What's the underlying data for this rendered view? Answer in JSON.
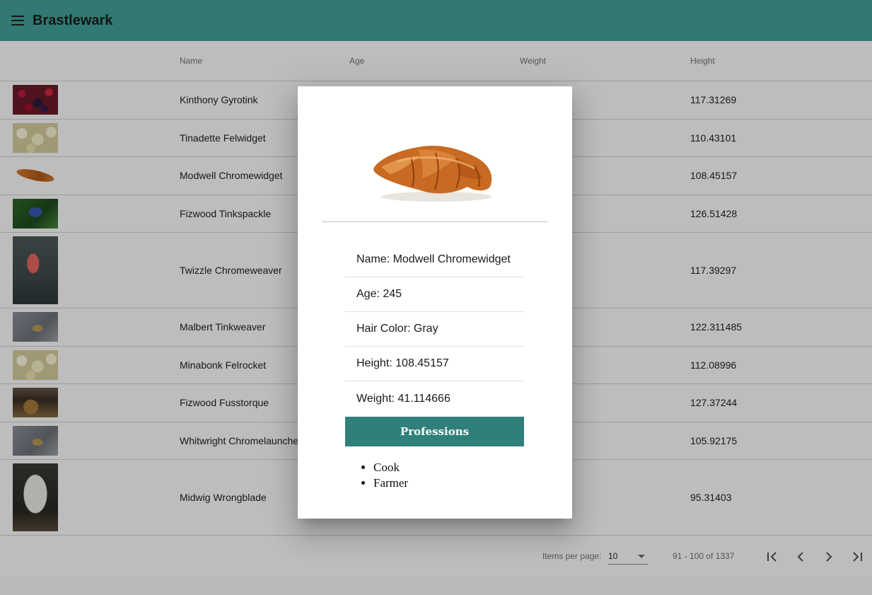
{
  "app": {
    "title": "Brastlewark"
  },
  "table": {
    "columns": [
      "",
      "Name",
      "Age",
      "Weight",
      "Height"
    ],
    "rows": [
      {
        "thumb": "berries",
        "name": "Kinthony Gyrotink",
        "height": "117.31269"
      },
      {
        "thumb": "popcorn",
        "name": "Tinadette Felwidget",
        "height": "110.43101"
      },
      {
        "thumb": "croissant",
        "name": "Modwell Chromewidget",
        "height": "108.45157"
      },
      {
        "thumb": "butterfly",
        "name": "Fizwood Tinkspackle",
        "height": "126.51428"
      },
      {
        "thumb": "flamingo",
        "name": "Twizzle Chromeweaver",
        "height": "117.39297"
      },
      {
        "thumb": "fish",
        "name": "Malbert Tinkweaver",
        "height": "122.311485"
      },
      {
        "thumb": "popcorn",
        "name": "Minabonk Felrocket",
        "height": "112.08996"
      },
      {
        "thumb": "hay",
        "name": "Fizwood Fusstorque",
        "height": "127.37244"
      },
      {
        "thumb": "fish",
        "name": "Whitwright Chromelauncher",
        "height": "105.92175"
      },
      {
        "thumb": "owl",
        "name": "Midwig Wrongblade",
        "height": "95.31403"
      }
    ]
  },
  "paginator": {
    "items_label": "Items per page:",
    "page_size": "10",
    "range": "91 - 100 of 1337"
  },
  "dialog": {
    "image": "croissant",
    "fields": [
      "Name: Modwell Chromewidget",
      "Age: 245",
      "Hair Color: Gray",
      "Height: 108.45157",
      "Weight: 41.114666"
    ],
    "professions_title": "Professions",
    "professions": [
      "Cook",
      "Farmer"
    ]
  },
  "colors": {
    "toolbar": "#43a49a",
    "professions_header": "#2f7f7a"
  }
}
